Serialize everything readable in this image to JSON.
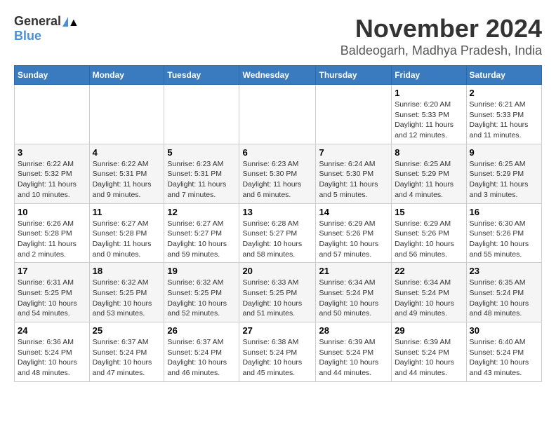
{
  "logo": {
    "general": "General",
    "blue": "Blue"
  },
  "title": "November 2024",
  "location": "Baldeogarh, Madhya Pradesh, India",
  "weekdays": [
    "Sunday",
    "Monday",
    "Tuesday",
    "Wednesday",
    "Thursday",
    "Friday",
    "Saturday"
  ],
  "weeks": [
    [
      {
        "day": "",
        "info": ""
      },
      {
        "day": "",
        "info": ""
      },
      {
        "day": "",
        "info": ""
      },
      {
        "day": "",
        "info": ""
      },
      {
        "day": "",
        "info": ""
      },
      {
        "day": "1",
        "info": "Sunrise: 6:20 AM\nSunset: 5:33 PM\nDaylight: 11 hours and 12 minutes."
      },
      {
        "day": "2",
        "info": "Sunrise: 6:21 AM\nSunset: 5:33 PM\nDaylight: 11 hours and 11 minutes."
      }
    ],
    [
      {
        "day": "3",
        "info": "Sunrise: 6:22 AM\nSunset: 5:32 PM\nDaylight: 11 hours and 10 minutes."
      },
      {
        "day": "4",
        "info": "Sunrise: 6:22 AM\nSunset: 5:31 PM\nDaylight: 11 hours and 9 minutes."
      },
      {
        "day": "5",
        "info": "Sunrise: 6:23 AM\nSunset: 5:31 PM\nDaylight: 11 hours and 7 minutes."
      },
      {
        "day": "6",
        "info": "Sunrise: 6:23 AM\nSunset: 5:30 PM\nDaylight: 11 hours and 6 minutes."
      },
      {
        "day": "7",
        "info": "Sunrise: 6:24 AM\nSunset: 5:30 PM\nDaylight: 11 hours and 5 minutes."
      },
      {
        "day": "8",
        "info": "Sunrise: 6:25 AM\nSunset: 5:29 PM\nDaylight: 11 hours and 4 minutes."
      },
      {
        "day": "9",
        "info": "Sunrise: 6:25 AM\nSunset: 5:29 PM\nDaylight: 11 hours and 3 minutes."
      }
    ],
    [
      {
        "day": "10",
        "info": "Sunrise: 6:26 AM\nSunset: 5:28 PM\nDaylight: 11 hours and 2 minutes."
      },
      {
        "day": "11",
        "info": "Sunrise: 6:27 AM\nSunset: 5:28 PM\nDaylight: 11 hours and 0 minutes."
      },
      {
        "day": "12",
        "info": "Sunrise: 6:27 AM\nSunset: 5:27 PM\nDaylight: 10 hours and 59 minutes."
      },
      {
        "day": "13",
        "info": "Sunrise: 6:28 AM\nSunset: 5:27 PM\nDaylight: 10 hours and 58 minutes."
      },
      {
        "day": "14",
        "info": "Sunrise: 6:29 AM\nSunset: 5:26 PM\nDaylight: 10 hours and 57 minutes."
      },
      {
        "day": "15",
        "info": "Sunrise: 6:29 AM\nSunset: 5:26 PM\nDaylight: 10 hours and 56 minutes."
      },
      {
        "day": "16",
        "info": "Sunrise: 6:30 AM\nSunset: 5:26 PM\nDaylight: 10 hours and 55 minutes."
      }
    ],
    [
      {
        "day": "17",
        "info": "Sunrise: 6:31 AM\nSunset: 5:25 PM\nDaylight: 10 hours and 54 minutes."
      },
      {
        "day": "18",
        "info": "Sunrise: 6:32 AM\nSunset: 5:25 PM\nDaylight: 10 hours and 53 minutes."
      },
      {
        "day": "19",
        "info": "Sunrise: 6:32 AM\nSunset: 5:25 PM\nDaylight: 10 hours and 52 minutes."
      },
      {
        "day": "20",
        "info": "Sunrise: 6:33 AM\nSunset: 5:25 PM\nDaylight: 10 hours and 51 minutes."
      },
      {
        "day": "21",
        "info": "Sunrise: 6:34 AM\nSunset: 5:24 PM\nDaylight: 10 hours and 50 minutes."
      },
      {
        "day": "22",
        "info": "Sunrise: 6:34 AM\nSunset: 5:24 PM\nDaylight: 10 hours and 49 minutes."
      },
      {
        "day": "23",
        "info": "Sunrise: 6:35 AM\nSunset: 5:24 PM\nDaylight: 10 hours and 48 minutes."
      }
    ],
    [
      {
        "day": "24",
        "info": "Sunrise: 6:36 AM\nSunset: 5:24 PM\nDaylight: 10 hours and 48 minutes."
      },
      {
        "day": "25",
        "info": "Sunrise: 6:37 AM\nSunset: 5:24 PM\nDaylight: 10 hours and 47 minutes."
      },
      {
        "day": "26",
        "info": "Sunrise: 6:37 AM\nSunset: 5:24 PM\nDaylight: 10 hours and 46 minutes."
      },
      {
        "day": "27",
        "info": "Sunrise: 6:38 AM\nSunset: 5:24 PM\nDaylight: 10 hours and 45 minutes."
      },
      {
        "day": "28",
        "info": "Sunrise: 6:39 AM\nSunset: 5:24 PM\nDaylight: 10 hours and 44 minutes."
      },
      {
        "day": "29",
        "info": "Sunrise: 6:39 AM\nSunset: 5:24 PM\nDaylight: 10 hours and 44 minutes."
      },
      {
        "day": "30",
        "info": "Sunrise: 6:40 AM\nSunset: 5:24 PM\nDaylight: 10 hours and 43 minutes."
      }
    ]
  ]
}
